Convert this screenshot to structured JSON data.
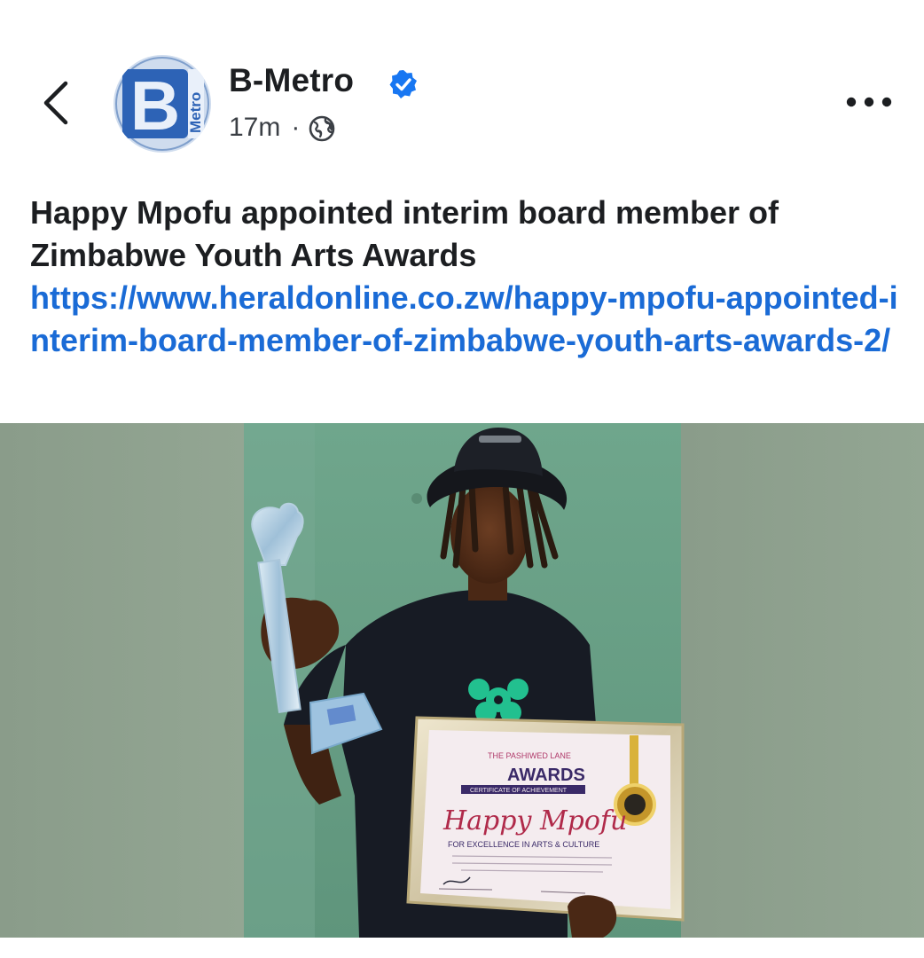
{
  "header": {
    "back_icon": "chevron-left-icon",
    "page_name": "B-Metro",
    "verified_icon": "verified-badge-icon",
    "time": "17m",
    "separator": "·",
    "audience_icon": "globe-icon",
    "more_icon": "more-horizontal-icon",
    "avatar_text": "B",
    "avatar_subtext": "Metro"
  },
  "post": {
    "title": "Happy Mpofu appointed interim board member of Zimbabwe Youth Arts Awards",
    "link": "https://www.heraldonline.co.zw/happy-mpofu-appointed-interim-board-member-of-zimbabwe-youth-arts-awards-2/"
  },
  "photo": {
    "certificate_brand": "THE PASHIWED LANE",
    "certificate_heading": "AWARDS",
    "certificate_subheading": "CERTIFICATE OF ACHIEVEMENT",
    "certificate_name": "Happy Mpofu",
    "certificate_line": "FOR EXCELLENCE IN ARTS & CULTURE"
  },
  "colors": {
    "link": "#1a6bd6",
    "verified": "#1877f2",
    "text": "#1c1e21",
    "muted": "#3b3f45"
  }
}
